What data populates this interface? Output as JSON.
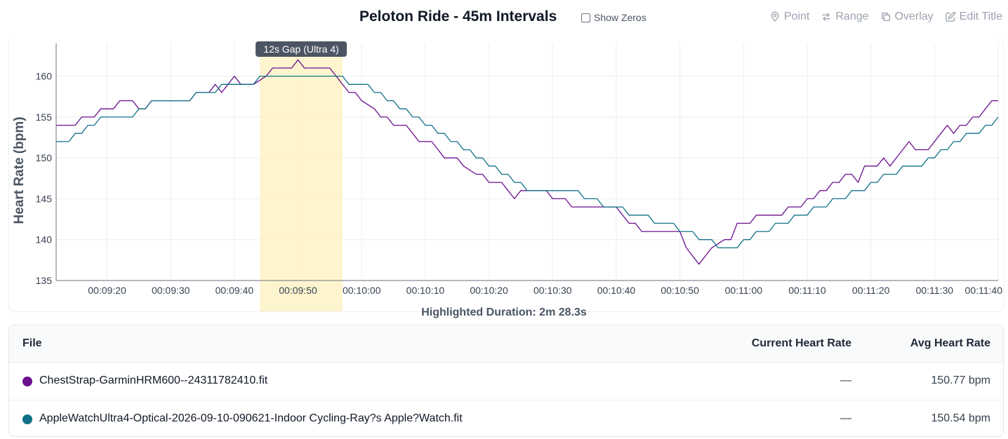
{
  "header": {
    "title": "Peloton Ride - 45m Intervals",
    "show_zeros_label": "Show Zeros",
    "tools": [
      {
        "label": "Point",
        "icon": "map-pin-icon"
      },
      {
        "label": "Range",
        "icon": "swap-arrows-icon"
      },
      {
        "label": "Overlay",
        "icon": "copy-icon"
      },
      {
        "label": "Edit Title",
        "icon": "edit-icon"
      }
    ]
  },
  "chart_data": {
    "type": "line",
    "ylabel": "Heart Rate (bpm)",
    "xlabel": "",
    "x_unit": "elapsed time",
    "xlim": [
      "00:09:12",
      "00:11:40"
    ],
    "ylim": [
      135,
      164
    ],
    "yticks": [
      135,
      140,
      145,
      150,
      155,
      160
    ],
    "xticks": [
      "00:09:20",
      "00:09:30",
      "00:09:40",
      "00:09:50",
      "00:10:00",
      "00:10:10",
      "00:10:20",
      "00:10:30",
      "00:10:40",
      "00:10:50",
      "00:11:00",
      "00:11:10",
      "00:11:20",
      "00:11:30",
      "00:11:40"
    ],
    "grid": true,
    "highlight": {
      "start": "00:09:44",
      "end": "00:09:57",
      "label": "12s Gap (Ultra 4)",
      "color": "#fef3c7"
    },
    "series": [
      {
        "name": "ChestStrap-GarminHRM600--24311782410.fit",
        "color": "#6b0f8e",
        "points": [
          [
            "00:09:12",
            154
          ],
          [
            "00:09:15",
            154
          ],
          [
            "00:09:16",
            155
          ],
          [
            "00:09:18",
            155
          ],
          [
            "00:09:19",
            156
          ],
          [
            "00:09:21",
            156
          ],
          [
            "00:09:22",
            157
          ],
          [
            "00:09:24",
            157
          ],
          [
            "00:09:25",
            156
          ],
          [
            "00:09:26",
            156
          ],
          [
            "00:09:27",
            157
          ],
          [
            "00:09:30",
            157
          ],
          [
            "00:09:31",
            157
          ],
          [
            "00:09:33",
            157
          ],
          [
            "00:09:34",
            158
          ],
          [
            "00:09:36",
            158
          ],
          [
            "00:09:37",
            159
          ],
          [
            "00:09:38",
            158
          ],
          [
            "00:09:39",
            159
          ],
          [
            "00:09:40",
            160
          ],
          [
            "00:09:41",
            159
          ],
          [
            "00:09:43",
            159
          ],
          [
            "00:09:45",
            160
          ],
          [
            "00:09:46",
            161
          ],
          [
            "00:09:49",
            161
          ],
          [
            "00:09:50",
            162
          ],
          [
            "00:09:51",
            161
          ],
          [
            "00:09:55",
            161
          ],
          [
            "00:09:57",
            159
          ],
          [
            "00:09:58",
            158
          ],
          [
            "00:09:59",
            158
          ],
          [
            "00:10:00",
            157
          ],
          [
            "00:10:02",
            156
          ],
          [
            "00:10:03",
            155
          ],
          [
            "00:10:04",
            155
          ],
          [
            "00:10:05",
            154
          ],
          [
            "00:10:07",
            154
          ],
          [
            "00:10:08",
            153
          ],
          [
            "00:10:09",
            152
          ],
          [
            "00:10:11",
            152
          ],
          [
            "00:10:12",
            151
          ],
          [
            "00:10:13",
            150
          ],
          [
            "00:10:15",
            150
          ],
          [
            "00:10:16",
            149
          ],
          [
            "00:10:18",
            148
          ],
          [
            "00:10:19",
            148
          ],
          [
            "00:10:20",
            147
          ],
          [
            "00:10:22",
            147
          ],
          [
            "00:10:23",
            146
          ],
          [
            "00:10:24",
            145
          ],
          [
            "00:10:25",
            146
          ],
          [
            "00:10:29",
            146
          ],
          [
            "00:10:30",
            145
          ],
          [
            "00:10:32",
            145
          ],
          [
            "00:10:33",
            144
          ],
          [
            "00:10:37",
            144
          ],
          [
            "00:10:40",
            144
          ],
          [
            "00:10:41",
            143
          ],
          [
            "00:10:42",
            142
          ],
          [
            "00:10:43",
            142
          ],
          [
            "00:10:44",
            141
          ],
          [
            "00:10:50",
            141
          ],
          [
            "00:10:51",
            139
          ],
          [
            "00:10:53",
            137
          ],
          [
            "00:10:55",
            139
          ],
          [
            "00:10:57",
            140
          ],
          [
            "00:10:58",
            140
          ],
          [
            "00:10:59",
            142
          ],
          [
            "00:11:01",
            142
          ],
          [
            "00:11:02",
            143
          ],
          [
            "00:11:06",
            143
          ],
          [
            "00:11:07",
            144
          ],
          [
            "00:11:09",
            144
          ],
          [
            "00:11:10",
            145
          ],
          [
            "00:11:11",
            145
          ],
          [
            "00:11:12",
            146
          ],
          [
            "00:11:13",
            146
          ],
          [
            "00:11:14",
            147
          ],
          [
            "00:11:15",
            147
          ],
          [
            "00:11:16",
            148
          ],
          [
            "00:11:17",
            148
          ],
          [
            "00:11:18",
            147
          ],
          [
            "00:11:19",
            149
          ],
          [
            "00:11:21",
            149
          ],
          [
            "00:11:22",
            150
          ],
          [
            "00:11:23",
            149
          ],
          [
            "00:11:25",
            151
          ],
          [
            "00:11:26",
            152
          ],
          [
            "00:11:27",
            151
          ],
          [
            "00:11:29",
            151
          ],
          [
            "00:11:31",
            153
          ],
          [
            "00:11:32",
            154
          ],
          [
            "00:11:33",
            153
          ],
          [
            "00:11:34",
            154
          ],
          [
            "00:11:35",
            154
          ],
          [
            "00:11:36",
            155
          ],
          [
            "00:11:37",
            155
          ],
          [
            "00:11:38",
            156
          ],
          [
            "00:11:39",
            157
          ],
          [
            "00:11:40",
            157
          ]
        ]
      },
      {
        "name": "AppleWatchUltra4-Optical-2026-09-10-090621-Indoor Cycling-Ray?s Apple?Watch.fit",
        "color": "#0f7187",
        "points": [
          [
            "00:09:12",
            152
          ],
          [
            "00:09:14",
            152
          ],
          [
            "00:09:15",
            153
          ],
          [
            "00:09:16",
            153
          ],
          [
            "00:09:17",
            154
          ],
          [
            "00:09:18",
            154
          ],
          [
            "00:09:19",
            155
          ],
          [
            "00:09:24",
            155
          ],
          [
            "00:09:25",
            156
          ],
          [
            "00:09:26",
            156
          ],
          [
            "00:09:27",
            157
          ],
          [
            "00:09:33",
            157
          ],
          [
            "00:09:34",
            158
          ],
          [
            "00:09:37",
            158
          ],
          [
            "00:09:38",
            159
          ],
          [
            "00:09:43",
            159
          ],
          [
            "00:09:44",
            160
          ],
          [
            "00:09:57",
            160
          ],
          [
            "00:09:58",
            159
          ],
          [
            "00:10:01",
            159
          ],
          [
            "00:10:02",
            158
          ],
          [
            "00:10:03",
            158
          ],
          [
            "00:10:04",
            157
          ],
          [
            "00:10:05",
            157
          ],
          [
            "00:10:06",
            156
          ],
          [
            "00:10:07",
            156
          ],
          [
            "00:10:08",
            155
          ],
          [
            "00:10:09",
            155
          ],
          [
            "00:10:10",
            154
          ],
          [
            "00:10:11",
            154
          ],
          [
            "00:10:12",
            153
          ],
          [
            "00:10:13",
            153
          ],
          [
            "00:10:14",
            152
          ],
          [
            "00:10:15",
            152
          ],
          [
            "00:10:16",
            151
          ],
          [
            "00:10:17",
            151
          ],
          [
            "00:10:18",
            150
          ],
          [
            "00:10:19",
            150
          ],
          [
            "00:10:20",
            149
          ],
          [
            "00:10:21",
            149
          ],
          [
            "00:10:22",
            148
          ],
          [
            "00:10:23",
            148
          ],
          [
            "00:10:24",
            147
          ],
          [
            "00:10:25",
            147
          ],
          [
            "00:10:26",
            146
          ],
          [
            "00:10:34",
            146
          ],
          [
            "00:10:35",
            145
          ],
          [
            "00:10:37",
            145
          ],
          [
            "00:10:38",
            144
          ],
          [
            "00:10:41",
            144
          ],
          [
            "00:10:42",
            143
          ],
          [
            "00:10:45",
            143
          ],
          [
            "00:10:46",
            142
          ],
          [
            "00:10:49",
            142
          ],
          [
            "00:10:50",
            141
          ],
          [
            "00:10:52",
            141
          ],
          [
            "00:10:53",
            140
          ],
          [
            "00:10:55",
            140
          ],
          [
            "00:10:56",
            139
          ],
          [
            "00:10:59",
            139
          ],
          [
            "00:11:00",
            140
          ],
          [
            "00:11:01",
            140
          ],
          [
            "00:11:02",
            141
          ],
          [
            "00:11:04",
            141
          ],
          [
            "00:11:05",
            142
          ],
          [
            "00:11:07",
            142
          ],
          [
            "00:11:08",
            143
          ],
          [
            "00:11:10",
            143
          ],
          [
            "00:11:11",
            144
          ],
          [
            "00:11:13",
            144
          ],
          [
            "00:11:14",
            145
          ],
          [
            "00:11:16",
            145
          ],
          [
            "00:11:17",
            146
          ],
          [
            "00:11:19",
            146
          ],
          [
            "00:11:20",
            147
          ],
          [
            "00:11:21",
            147
          ],
          [
            "00:11:22",
            148
          ],
          [
            "00:11:24",
            148
          ],
          [
            "00:11:25",
            149
          ],
          [
            "00:11:28",
            149
          ],
          [
            "00:11:29",
            150
          ],
          [
            "00:11:30",
            150
          ],
          [
            "00:11:31",
            151
          ],
          [
            "00:11:32",
            151
          ],
          [
            "00:11:33",
            152
          ],
          [
            "00:11:34",
            152
          ],
          [
            "00:11:35",
            153
          ],
          [
            "00:11:37",
            153
          ],
          [
            "00:11:38",
            154
          ],
          [
            "00:11:39",
            154
          ],
          [
            "00:11:40",
            155
          ]
        ]
      }
    ]
  },
  "summary": {
    "duration_text": "Highlighted Duration: 2m 28.3s"
  },
  "table": {
    "headers": {
      "file": "File",
      "current": "Current Heart Rate",
      "avg": "Avg Heart Rate"
    },
    "rows": [
      {
        "file": "ChestStrap-GarminHRM600--24311782410.fit",
        "current": "—",
        "avg": "150.77 bpm",
        "color": "#6b0f8e"
      },
      {
        "file": "AppleWatchUltra4-Optical-2026-09-10-090621-Indoor Cycling-Ray?s Apple?Watch.fit",
        "current": "—",
        "avg": "150.54 bpm",
        "color": "#0f7187"
      }
    ]
  }
}
